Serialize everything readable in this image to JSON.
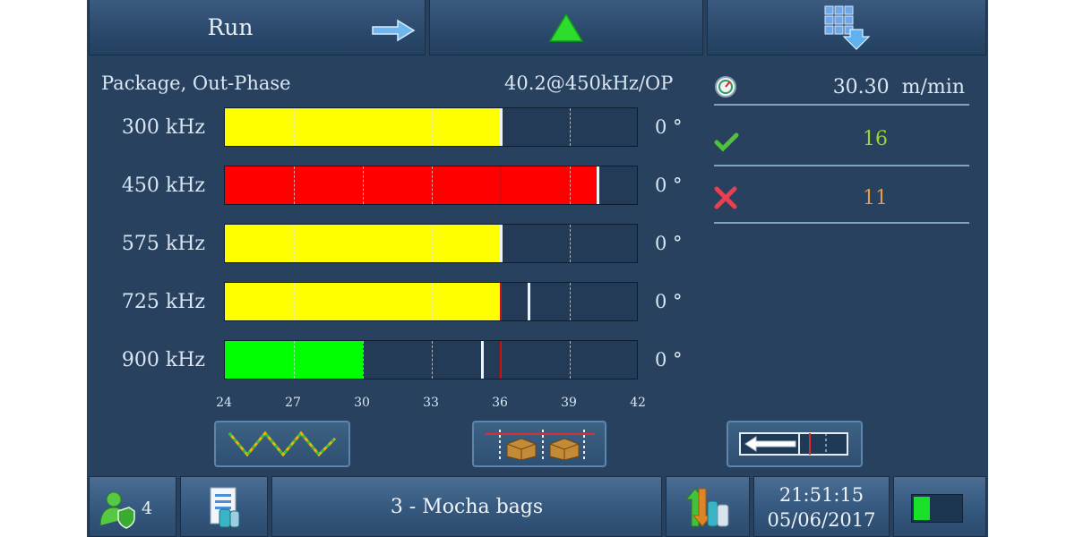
{
  "top": {
    "run_label": "Run"
  },
  "header": {
    "program": "Package, Out-Phase",
    "reading": "40.2@450kHz/OP"
  },
  "channels": [
    {
      "freq": "300 kHz",
      "phase": "0 °",
      "fill": 36.0,
      "color": "#ffff00",
      "marker": 36.0
    },
    {
      "freq": "450 kHz",
      "phase": "0 °",
      "fill": 40.2,
      "color": "#ff0000",
      "marker": 40.2
    },
    {
      "freq": "575 kHz",
      "phase": "0 °",
      "fill": 36.0,
      "color": "#ffff00",
      "marker": 36.0
    },
    {
      "freq": "725 kHz",
      "phase": "0 °",
      "fill": 36.0,
      "color": "#ffff00",
      "marker": 37.2
    },
    {
      "freq": "900 kHz",
      "phase": "0 °",
      "fill": 30.0,
      "color": "#00ff00",
      "marker": 35.2
    }
  ],
  "scale": {
    "min": 24,
    "max": 42,
    "threshold": 36,
    "ticks": [
      "24",
      "27",
      "30",
      "33",
      "36",
      "39",
      "42"
    ]
  },
  "stats": {
    "speed": "30.30  m/min",
    "good": "16",
    "rejected": "11",
    "good_color": "#9ed22f",
    "rejected_color": "#e59a46"
  },
  "footer": {
    "user_count": "4",
    "product": "3 - Mocha bags",
    "time": "21:51:15",
    "date": "05/06/2017"
  }
}
